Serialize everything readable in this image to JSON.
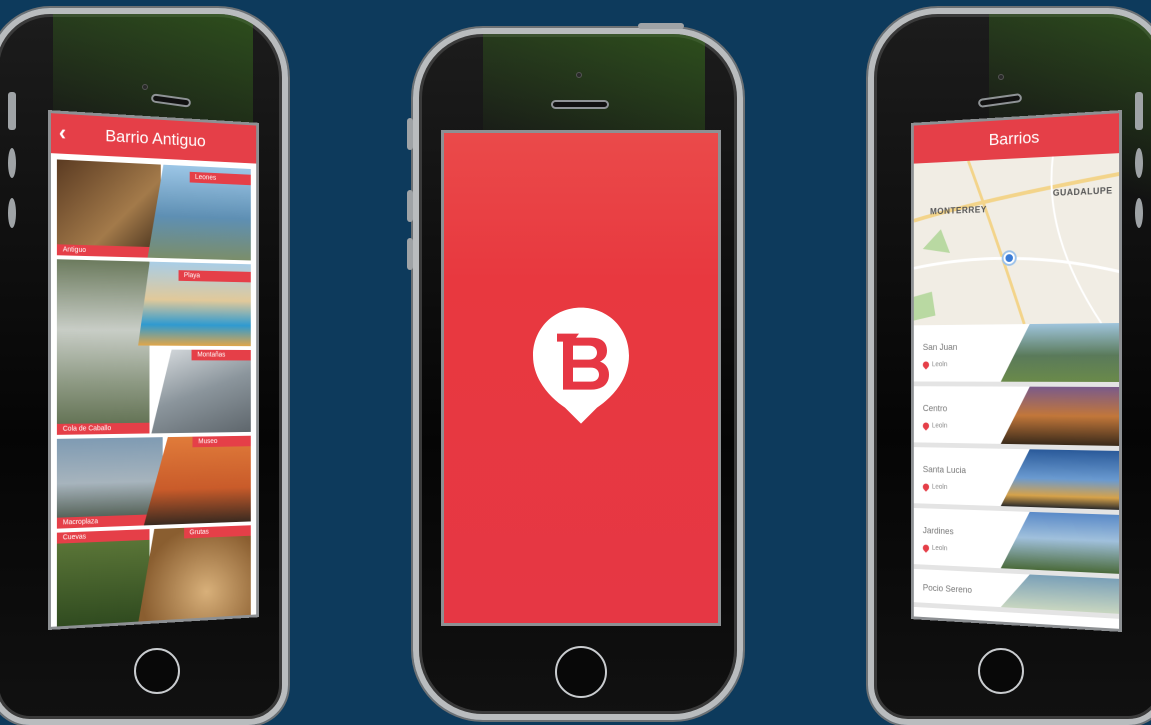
{
  "left_phone": {
    "header_title": "Barrio Antiguo",
    "back_icon": "chevron-left-icon",
    "tiles": [
      {
        "label": "Antiguo",
        "color": "#7a5a3a"
      },
      {
        "label": "Leones",
        "color": "#6fa3c9"
      },
      {
        "label": "Cola de Caballo",
        "color": "#8c9a84"
      },
      {
        "label": "Playa",
        "color": "#c9b07a"
      },
      {
        "label": "Montañas",
        "color": "#9aa3a8"
      },
      {
        "label": "Macroplaza",
        "color": "#7b8fa0"
      },
      {
        "label": "Museo",
        "color": "#d26f3a"
      },
      {
        "label": "Cuevas",
        "color": "#4e6b3b"
      },
      {
        "label": "Grutas",
        "color": "#b08a5a"
      }
    ]
  },
  "center_phone": {
    "logo_letter": "B",
    "background": "#e63744"
  },
  "right_phone": {
    "header_title": "Barrios",
    "map": {
      "city1": "MONTERREY",
      "city2": "GUADALUPE"
    },
    "items": [
      {
        "name": "San Juan",
        "location": "Leoln",
        "color": "#5a8a6a"
      },
      {
        "name": "Centro",
        "location": "Leoln",
        "color": "#c2773a"
      },
      {
        "name": "Santa Lucia",
        "location": "Leoln",
        "color": "#3a6ea5"
      },
      {
        "name": "Jardines",
        "location": "Leoln",
        "color": "#4a7fb8"
      },
      {
        "name": "Pocio Sereno",
        "location": "",
        "color": "#7aa0b8"
      }
    ]
  }
}
